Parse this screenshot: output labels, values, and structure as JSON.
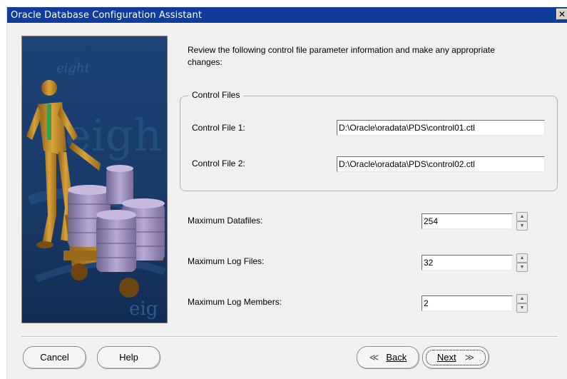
{
  "window": {
    "title": "Oracle Database Configuration Assistant",
    "close_glyph": "✕"
  },
  "intro": "Review the following control file parameter information and make any appropriate changes:",
  "control_files": {
    "legend": "Control Files",
    "file1_label": "Control File 1:",
    "file1_value": "D:\\Oracle\\oradata\\PDS\\control01.ctl",
    "file2_label": "Control File 2:",
    "file2_value": "D:\\Oracle\\oradata\\PDS\\control02.ctl"
  },
  "params": {
    "max_datafiles_label": "Maximum Datafiles:",
    "max_datafiles_value": "254",
    "max_logfiles_label": "Maximum Log Files:",
    "max_logfiles_value": "32",
    "max_logmembers_label": "Maximum Log Members:",
    "max_logmembers_value": "2"
  },
  "buttons": {
    "cancel": "Cancel",
    "help": "Help",
    "back": "Back",
    "next": "Next"
  },
  "graphic": {
    "watermark_words": [
      "eight",
      "eigh",
      "eig"
    ]
  },
  "icons": {
    "back": "double-chevron-left-icon",
    "next": "double-chevron-right-icon",
    "close": "close-icon",
    "spin_up": "triangle-up-icon",
    "spin_down": "triangle-down-icon"
  }
}
